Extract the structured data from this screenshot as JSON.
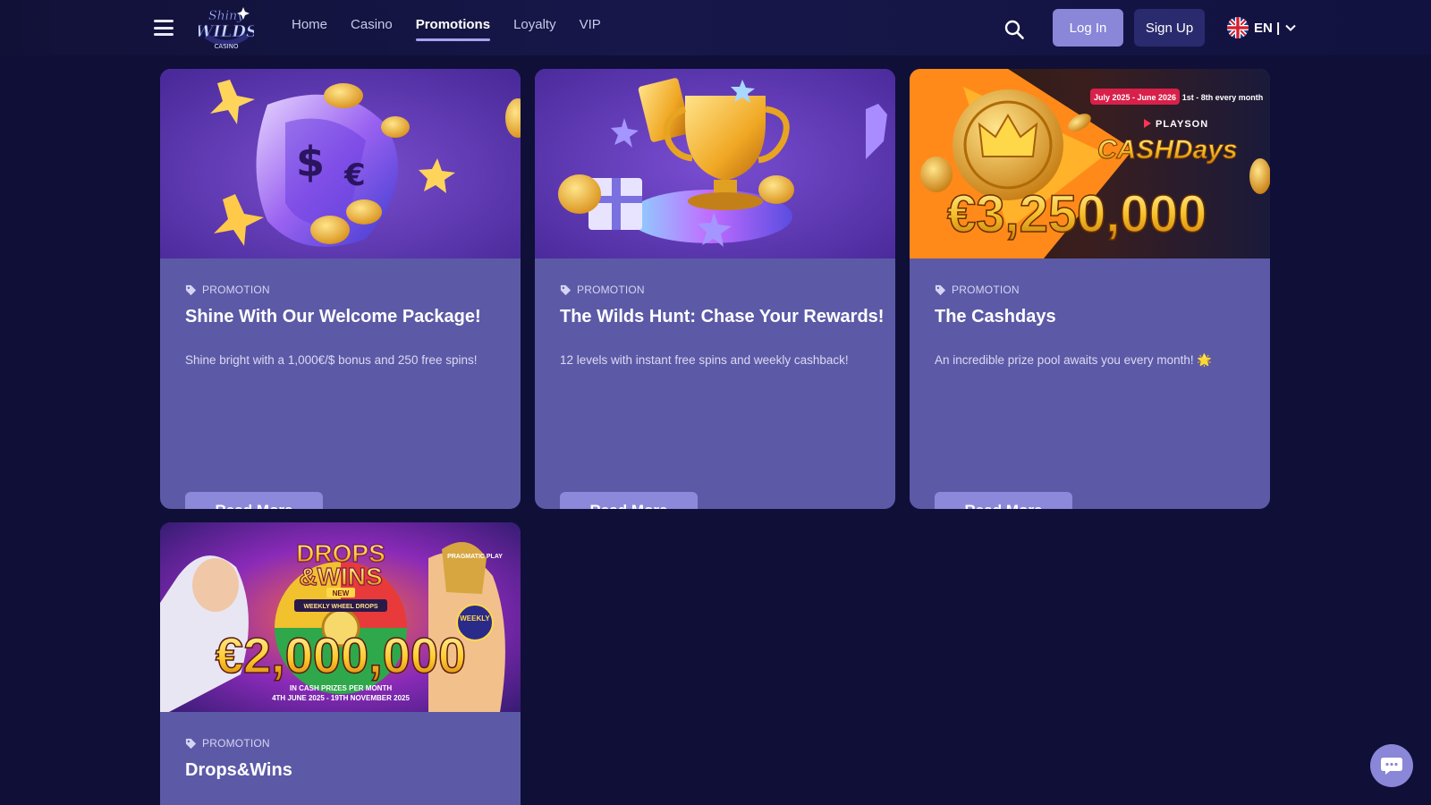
{
  "header": {
    "logo_text_top": "Shiny",
    "logo_text_main": "WILDS",
    "logo_text_bottom": "CASINO",
    "nav": [
      {
        "label": "Home",
        "active": false
      },
      {
        "label": "Casino",
        "active": false
      },
      {
        "label": "Promotions",
        "active": true
      },
      {
        "label": "Loyalty",
        "active": false
      },
      {
        "label": "VIP",
        "active": false
      }
    ],
    "login_label": "Log In",
    "signup_label": "Sign Up",
    "language": "EN |"
  },
  "promotions": [
    {
      "tag": "PROMOTION",
      "title": "Shine With Our Welcome Package!",
      "description": "Shine bright with a 1,000€/$ bonus and 250 free spins!",
      "button": "Read More"
    },
    {
      "tag": "PROMOTION",
      "title": "The Wilds Hunt: Chase Your Rewards!",
      "description": "12 levels with instant free spins and weekly cashback!",
      "button": "Read More"
    },
    {
      "tag": "PROMOTION",
      "title": "The Cashdays",
      "description": "An incredible prize pool awaits you every month! 🌟",
      "button": "Read More",
      "banner": {
        "date_range": "July 2025 - June 2026",
        "schedule": "1st - 8th every month",
        "provider": "PLAYSON",
        "brand": "CASHDays",
        "amount": "€3,250,000"
      }
    },
    {
      "tag": "PROMOTION",
      "title": "Drops&Wins",
      "banner": {
        "brand_line1": "DROPS",
        "brand_line2": "&WINS",
        "badge": "NEW",
        "sub": "WEEKLY WHEEL DROPS",
        "provider": "PRAGMATIC PLAY",
        "weekly_badge": "WEEKLY",
        "amount": "€2,000,000",
        "caption": "IN CASH PRIZES PER MONTH",
        "dates": "4TH JUNE 2025 - 19TH NOVEMBER 2025"
      }
    }
  ],
  "colors": {
    "page_bg": "#0f0f38",
    "card_bg": "#5c5aa6",
    "button": "#8d89da",
    "accent_gold": "#f3b52a"
  }
}
